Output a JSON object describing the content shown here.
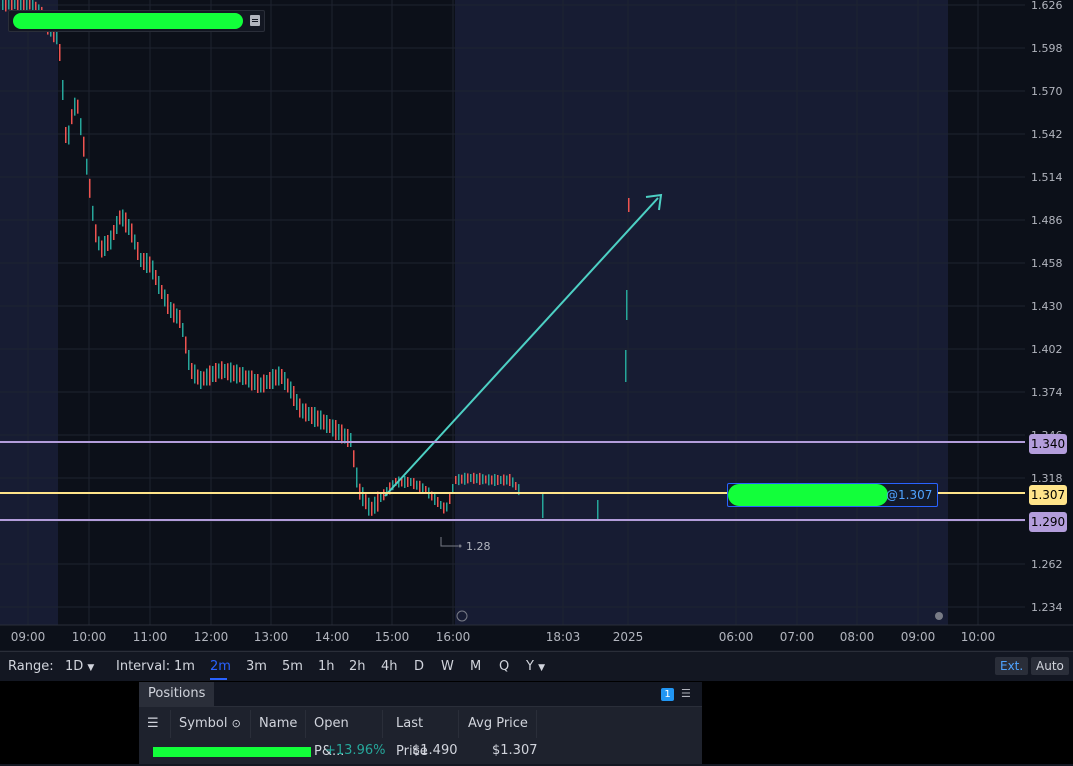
{
  "chart": {
    "price_axis": [
      "1.626",
      "1.598",
      "1.570",
      "1.542",
      "1.514",
      "1.486",
      "1.458",
      "1.430",
      "1.402",
      "1.374",
      "1.346",
      "1.318",
      "1.290",
      "1.262",
      "1.234"
    ],
    "time_axis": [
      "09:00",
      "10:00",
      "11:00",
      "12:00",
      "13:00",
      "14:00",
      "15:00",
      "16:00",
      "18:03",
      "2025",
      "06:00",
      "07:00",
      "08:00",
      "09:00",
      "10:00"
    ],
    "levels": [
      {
        "label": "1.340",
        "color": "#b39ddb"
      },
      {
        "label": "1.307",
        "color": "#ffe48a"
      },
      {
        "label": "1.290",
        "color": "#b39ddb"
      }
    ],
    "order_label": "@1.307",
    "low_marker": "1.28",
    "colors": {
      "up": "#26a69a",
      "down": "#ef5350",
      "arrow": "#4dd0c4",
      "session_bg": "#171c33"
    }
  },
  "toolbar": {
    "range_label": "Range:",
    "range_value": "1D",
    "interval_label": "Interval:",
    "intervals": [
      "1m",
      "2m",
      "3m",
      "5m",
      "1h",
      "2h",
      "4h",
      "D",
      "W",
      "M",
      "Q",
      "Y"
    ],
    "active_interval": "2m",
    "ext_label": "Ext.",
    "auto_label": "Auto"
  },
  "positions": {
    "title": "Positions",
    "count": "1",
    "columns": [
      "Symbol",
      "Name",
      "Open P&...",
      "Last Price",
      "Avg Price"
    ],
    "rows": [
      {
        "open_pl": "+13.96%",
        "last_price": "$1.490",
        "avg_price": "$1.307"
      }
    ]
  }
}
